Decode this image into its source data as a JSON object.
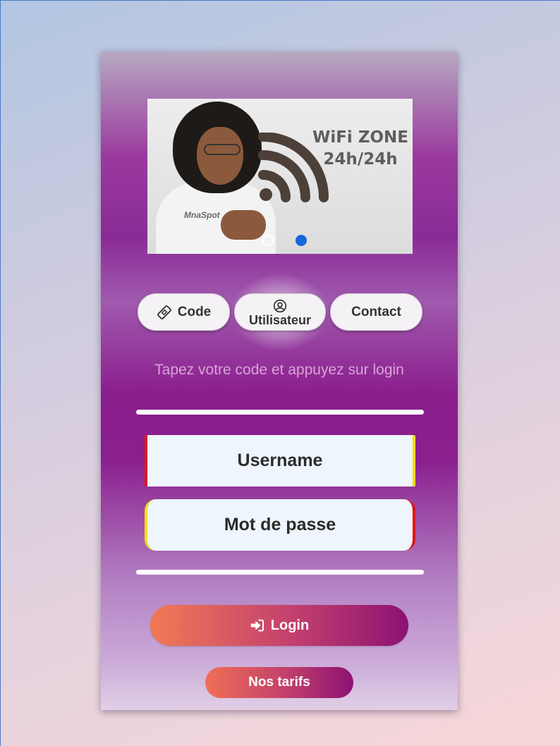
{
  "banner": {
    "title_line1": "WiFi ZONE",
    "title_line2": "24h/24h",
    "shirt_logo": "MnaSpot",
    "slides": 2,
    "active_slide": 2,
    "icon": "wifi-icon"
  },
  "tabs": {
    "code": {
      "label": "Code",
      "icon": "ticket-icon"
    },
    "user": {
      "label": "Utilisateur",
      "icon": "user-circle-icon"
    },
    "contact": {
      "label": "Contact"
    }
  },
  "form": {
    "hint": "Tapez votre code et appuyez sur login",
    "username_placeholder": "Username",
    "password_placeholder": "Mot de passe"
  },
  "buttons": {
    "login_label": "Login",
    "login_icon": "sign-in-icon",
    "tarifs_label": "Nos tarifs"
  },
  "colors": {
    "active_dot": "#1766d9",
    "login_gradient_start": "#f27a54",
    "login_gradient_end": "#8c1272",
    "field_bg": "#eef5fc"
  }
}
